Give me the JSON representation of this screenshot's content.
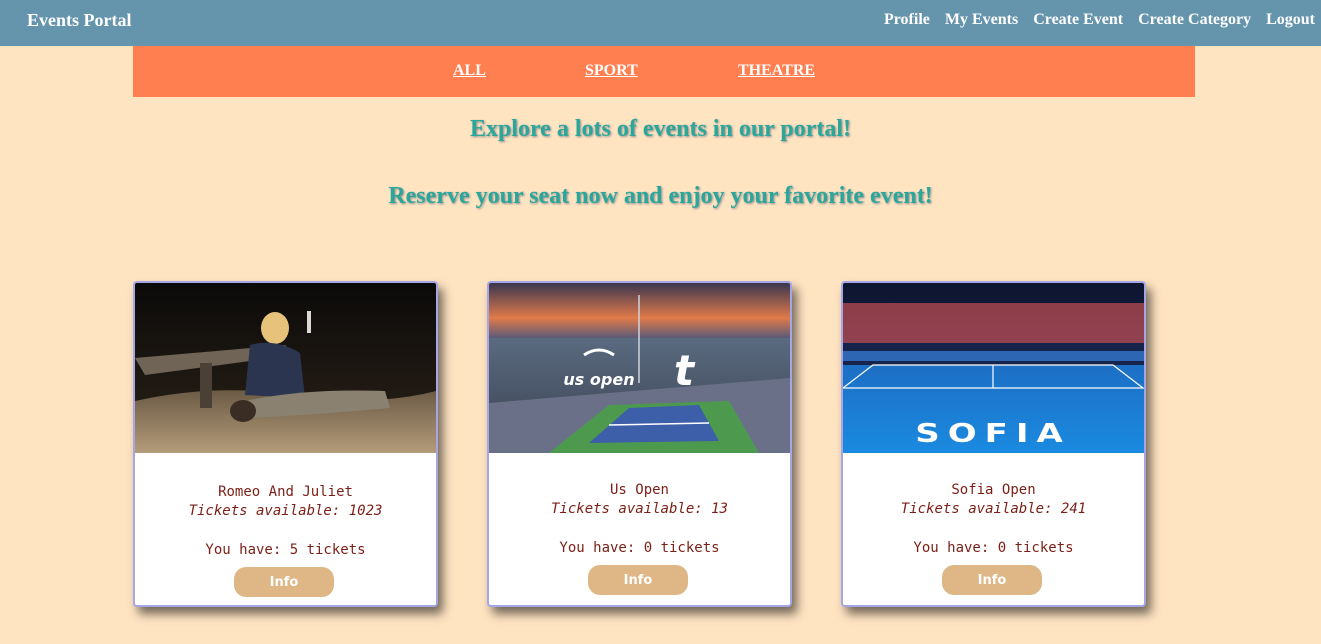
{
  "app": {
    "brand": "Events Portal"
  },
  "nav": {
    "items": [
      "Profile",
      "My Events",
      "Create Event",
      "Create Category",
      "Logout"
    ]
  },
  "categories": {
    "items": [
      "ALL",
      "SPORT",
      "THEATRE"
    ]
  },
  "hero": {
    "line1": "Explore a lots of events in our portal!",
    "line2": "Reserve your seat now and enjoy your favorite event!"
  },
  "events": [
    {
      "title": "Romeo And Juliet",
      "available": "Tickets available: 1023",
      "have": "You have: 5 tickets",
      "button": "Info"
    },
    {
      "title": "Us Open",
      "available": "Tickets available: 13",
      "have": "You have: 0 tickets",
      "button": "Info",
      "image_logo": "us open",
      "image_logo_2": "t"
    },
    {
      "title": "Sofia Open",
      "available": "Tickets available: 241",
      "have": "You have: 0 tickets",
      "button": "Info",
      "image_text": "SOFIA"
    }
  ],
  "colors": {
    "topbar": "#6594ad",
    "catbar": "#ff7f50",
    "background": "#ffe4c2",
    "headline": "#2aa79a",
    "card_text": "#7b1f16",
    "button": "#dfb787"
  }
}
